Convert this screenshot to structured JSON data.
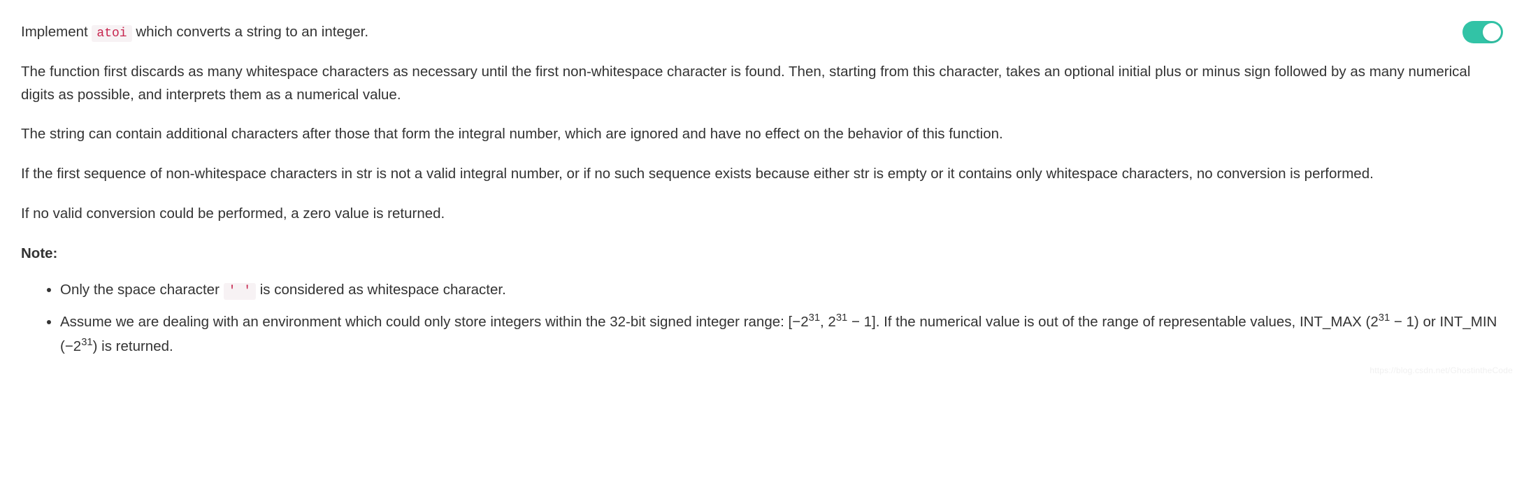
{
  "p1": {
    "pre": "Implement ",
    "code": "atoi",
    "post": " which converts a string to an integer."
  },
  "p2": "The function first discards as many whitespace characters as necessary until the first non-whitespace character is found. Then, starting from this character, takes an optional initial plus or minus sign followed by as many numerical digits as possible, and interprets them as a numerical value.",
  "p3": "The string can contain additional characters after those that form the integral number, which are ignored and have no effect on the behavior of this function.",
  "p4": "If the first sequence of non-whitespace characters in str is not a valid integral number, or if no such sequence exists because either str is empty or it contains only whitespace characters, no conversion is performed.",
  "p5": "If no valid conversion could be performed, a zero value is returned.",
  "note_label": "Note:",
  "li1": {
    "pre": "Only the space character ",
    "code": "' '",
    "post": " is considered as whitespace character."
  },
  "li2": {
    "t1": "Assume we are dealing with an environment which could only store integers within the 32-bit signed integer range: [−2",
    "sup1": "31",
    "t2": ",  2",
    "sup2": "31",
    "t3": " − 1]. If the numerical value is out of the range of representable values, INT_MAX (2",
    "sup3": "31",
    "t4": " − 1) or INT_MIN (−2",
    "sup4": "31",
    "t5": ") is returned."
  },
  "toggle": {
    "state": "on"
  },
  "watermark": "https://blog.csdn.net/GhostintheCode"
}
